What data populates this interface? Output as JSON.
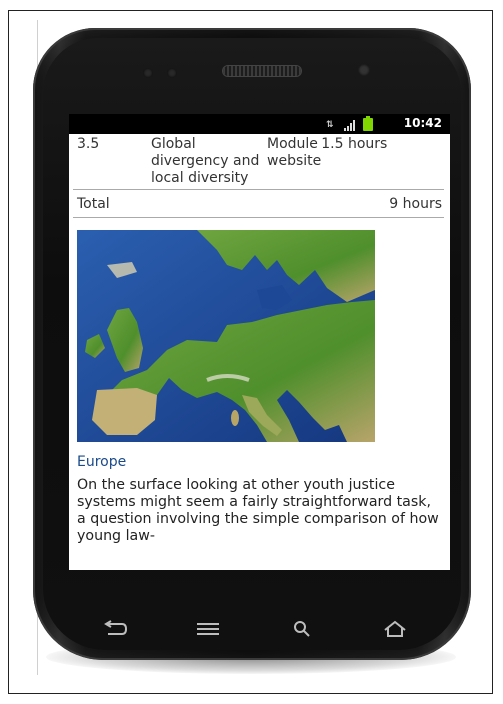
{
  "status_bar": {
    "time": "10:42",
    "icons": [
      "network-activity-icon",
      "signal-bars-icon",
      "battery-charging-icon"
    ]
  },
  "table": {
    "rows": [
      {
        "num": "3.5",
        "topic": "Global divergency and local diversity",
        "type": "Module website",
        "time": "1.5 hours"
      }
    ],
    "total": {
      "label": "Total",
      "value": "9 hours"
    }
  },
  "figure": {
    "image": "map-of-europe",
    "caption": "Europe"
  },
  "body_text": "On the surface looking at other youth justice systems might seem a fairly straightforward task, a question involving the simple comparison of how young law-",
  "nav_buttons": [
    "back-icon",
    "menu-icon",
    "search-icon",
    "home-icon"
  ],
  "colors": {
    "caption_link": "#1a4a8a",
    "status_bar": "#000000",
    "battery": "#7fd600",
    "sea": "#1a3f8e",
    "land": "#4f8f2c"
  }
}
